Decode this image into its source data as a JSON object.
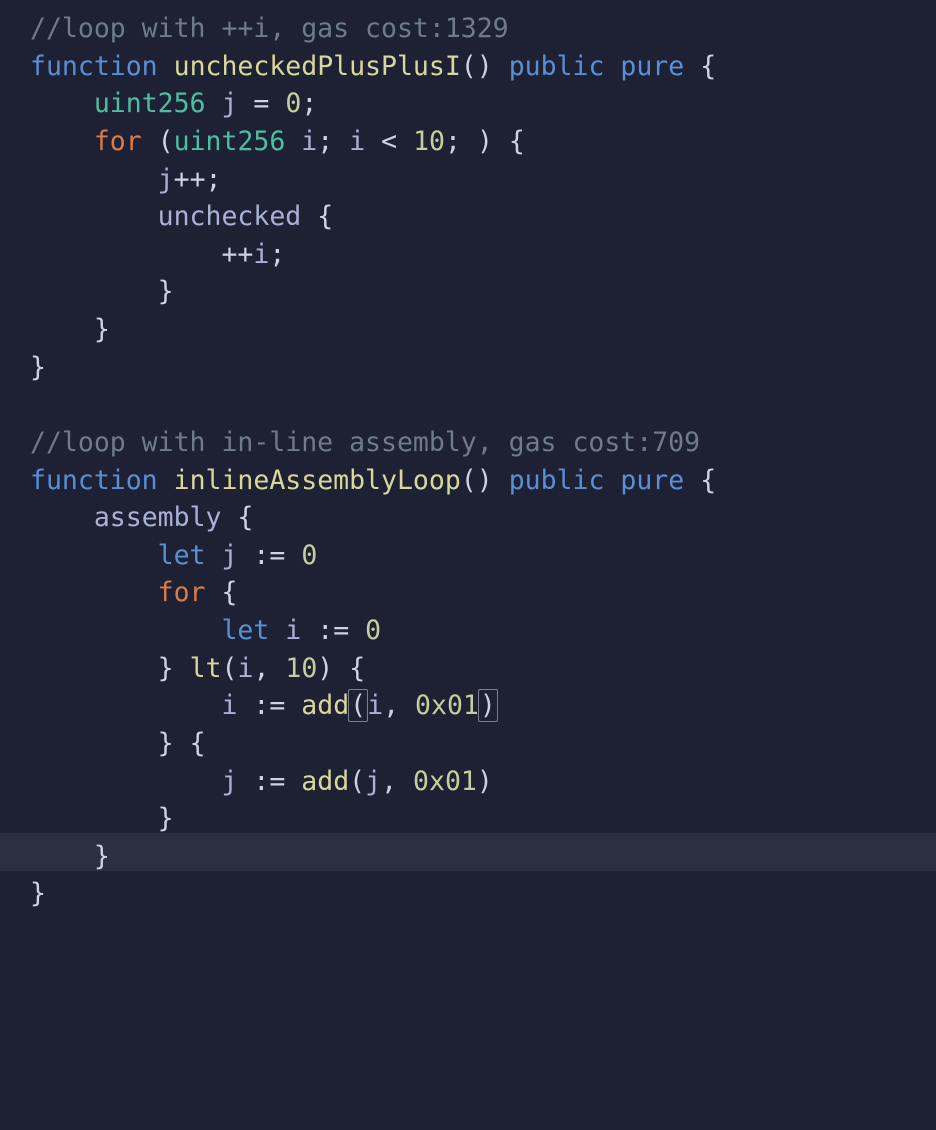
{
  "comment1": "//loop with ++i, gas cost:1329",
  "comment2": "//loop with in-line assembly, gas cost:709",
  "func1": {
    "kw_function": "function",
    "name": "uncheckedPlusPlusI",
    "kw_public": "public",
    "kw_pure": "pure",
    "type_uint256": "uint256",
    "var_j": "j",
    "num_0": "0",
    "kw_for": "for",
    "var_i": "i",
    "num_10": "10",
    "body_jpp": "j++",
    "kw_unchecked": "unchecked",
    "body_ppi": "++i"
  },
  "func2": {
    "kw_function": "function",
    "name": "inlineAssemblyLoop",
    "kw_public": "public",
    "kw_pure": "pure",
    "kw_assembly": "assembly",
    "kw_let": "let",
    "var_j": "j",
    "num_0": "0",
    "kw_for": "for",
    "var_i": "i",
    "fn_lt": "lt",
    "num_10": "10",
    "fn_add": "add",
    "hex_01": "0x01"
  }
}
